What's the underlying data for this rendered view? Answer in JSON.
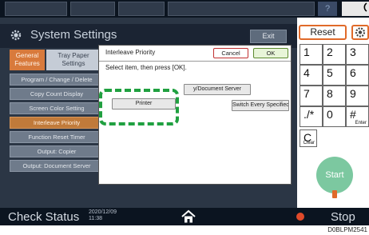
{
  "window": {
    "title": "System Settings",
    "exit_label": "Exit",
    "help_label": "?"
  },
  "tabs": [
    {
      "label": "General Features"
    },
    {
      "label": "Tray Paper Settings"
    }
  ],
  "menu": [
    {
      "label": "Program / Change / Delete"
    },
    {
      "label": "Copy Count Display"
    },
    {
      "label": "Screen Color Setting"
    },
    {
      "label": "Interleave Priority",
      "active": true
    },
    {
      "label": "Function Reset Timer"
    },
    {
      "label": "Output: Copier"
    },
    {
      "label": "Output: Document Server"
    }
  ],
  "dialog": {
    "title": "Interleave Priority",
    "cancel_label": "Cancel",
    "ok_label": "OK",
    "instruction": "Select item, then press [OK].",
    "options": {
      "copier_doc": "y/Document Server",
      "printer": "Printer",
      "switch": "Switch Every Specified No."
    }
  },
  "status": {
    "check_status": "Check Status",
    "date": "2020/12/09",
    "time": "11:38",
    "stop_label": "Stop"
  },
  "keypad": {
    "reset_label": "Reset",
    "keys": [
      {
        "label": "1"
      },
      {
        "label": "2"
      },
      {
        "label": "3"
      },
      {
        "label": "4"
      },
      {
        "label": "5"
      },
      {
        "label": "6"
      },
      {
        "label": "7"
      },
      {
        "label": "8"
      },
      {
        "label": "9"
      },
      {
        "label": "./*"
      },
      {
        "label": "0"
      },
      {
        "label": "#",
        "sub": "Enter"
      },
      {
        "label": "C",
        "sub": "Clear"
      }
    ],
    "start_label": "Start"
  },
  "image_code": "D0BLPM2541",
  "colors": {
    "accent_orange": "#e06a2a",
    "highlight_green": "#20a040",
    "start_green": "#7cc8a0",
    "panel_dark": "#2b3645"
  }
}
